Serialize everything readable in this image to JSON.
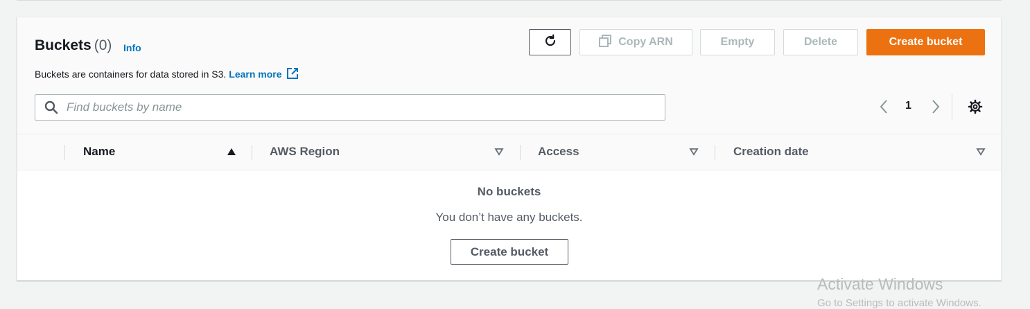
{
  "header": {
    "title": "Buckets",
    "count": "(0)",
    "info": "Info",
    "description": "Buckets are containers for data stored in S3.",
    "learn_more": "Learn more"
  },
  "toolbar": {
    "refresh_icon": "refresh-icon",
    "copy_arn_label": "Copy ARN",
    "empty_label": "Empty",
    "delete_label": "Delete",
    "create_label": "Create bucket"
  },
  "search": {
    "placeholder": "Find buckets by name",
    "value": ""
  },
  "pagination": {
    "current_page": "1"
  },
  "table": {
    "columns": [
      {
        "label": "Name",
        "sort": "ascending"
      },
      {
        "label": "AWS Region",
        "sort": "none"
      },
      {
        "label": "Access",
        "sort": "none"
      },
      {
        "label": "Creation date",
        "sort": "none"
      }
    ],
    "rows": []
  },
  "empty_state": {
    "title": "No buckets",
    "message": "You don’t have any buckets.",
    "action_label": "Create bucket"
  },
  "watermark": {
    "line1": "Activate Windows",
    "line2": "Go to Settings to activate Windows."
  },
  "colors": {
    "primary": "#ec7211",
    "link": "#0073bb",
    "text": "#16191f",
    "muted": "#545b64",
    "disabled": "#aab7b8"
  }
}
